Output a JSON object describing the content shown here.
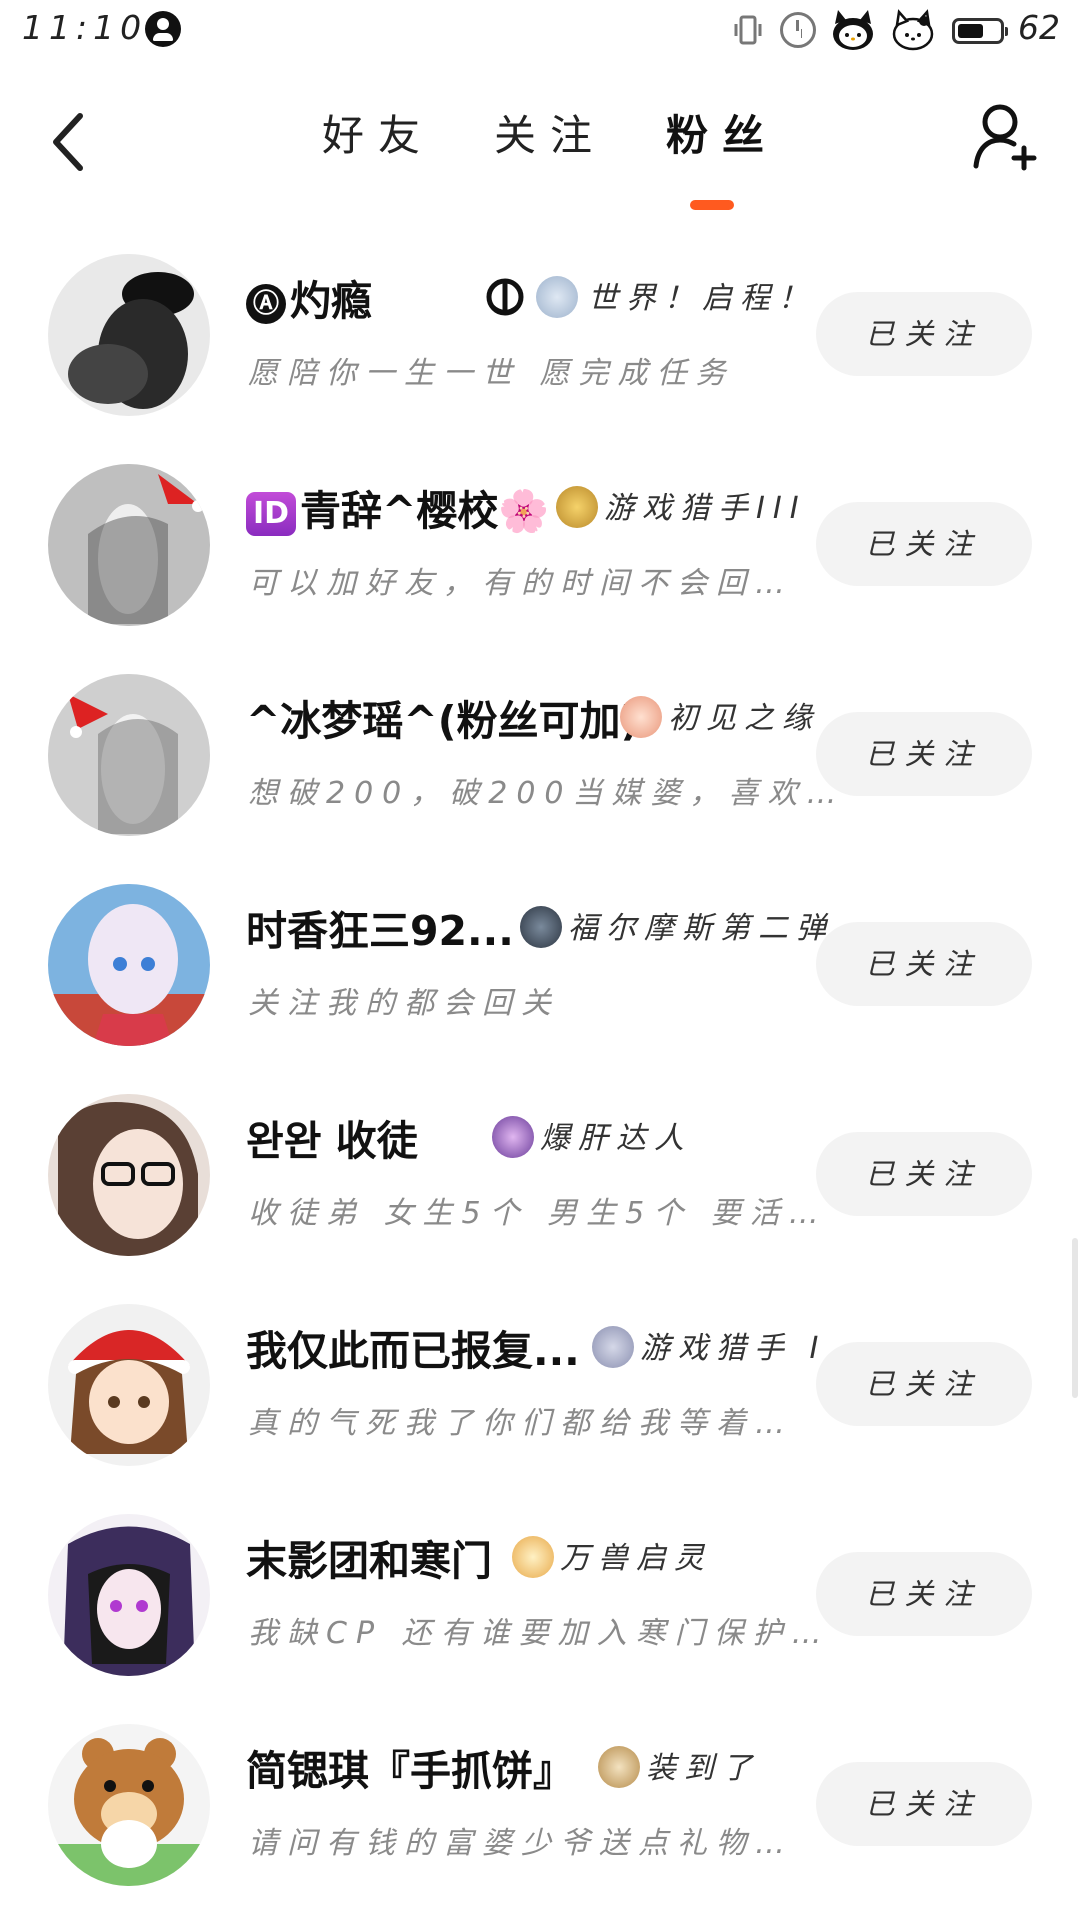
{
  "status_bar": {
    "time": "11:10",
    "battery_level": 62,
    "battery_text": "62"
  },
  "header": {
    "tabs": [
      {
        "label": "好友"
      },
      {
        "label": "关注"
      },
      {
        "label": "粉丝",
        "active": true
      }
    ],
    "accent_color": "#ff5a1f"
  },
  "followers": [
    {
      "prefix": "Ⓐ",
      "name": "灼瘾",
      "extra_icon": "khanda-symbol-icon",
      "badge": "世界！启程！",
      "desc": "愿陪你一生一世   愿完成任务",
      "button": "已关注"
    },
    {
      "prefix": "ID",
      "name": "青辞^樱校🌸",
      "badge": "游戏猎手III",
      "desc": "可以加好友，有的时间不会回…",
      "button": "已关注"
    },
    {
      "name": "^冰梦瑶^(粉丝可加)",
      "badge": "初见之缘",
      "desc": "想破200，破200当媒婆，喜欢…",
      "button": "已关注"
    },
    {
      "name": "时香狂三92...",
      "badge": "福尔摩斯第二弹",
      "desc": "关注我的都会回关",
      "button": "已关注"
    },
    {
      "name": "󠀠󠀠완완 收徒",
      "badge": "爆肝达人",
      "desc": "收徒弟 女生5个 男生5个 要活…",
      "button": "已关注"
    },
    {
      "name": "我仅此而已报复...",
      "badge": "游戏猎手 I",
      "desc": "真的气死我了你们都给我等着…",
      "button": "已关注"
    },
    {
      "name": "末影团和寒门",
      "badge": "万兽启灵",
      "desc": "我缺CP 还有谁要加入寒门保护…",
      "button": "已关注"
    },
    {
      "name": "简锶琪『手抓饼』",
      "badge": "装到了",
      "desc": "请问有钱的富婆少爷送点礼物…",
      "button": "已关注"
    }
  ]
}
